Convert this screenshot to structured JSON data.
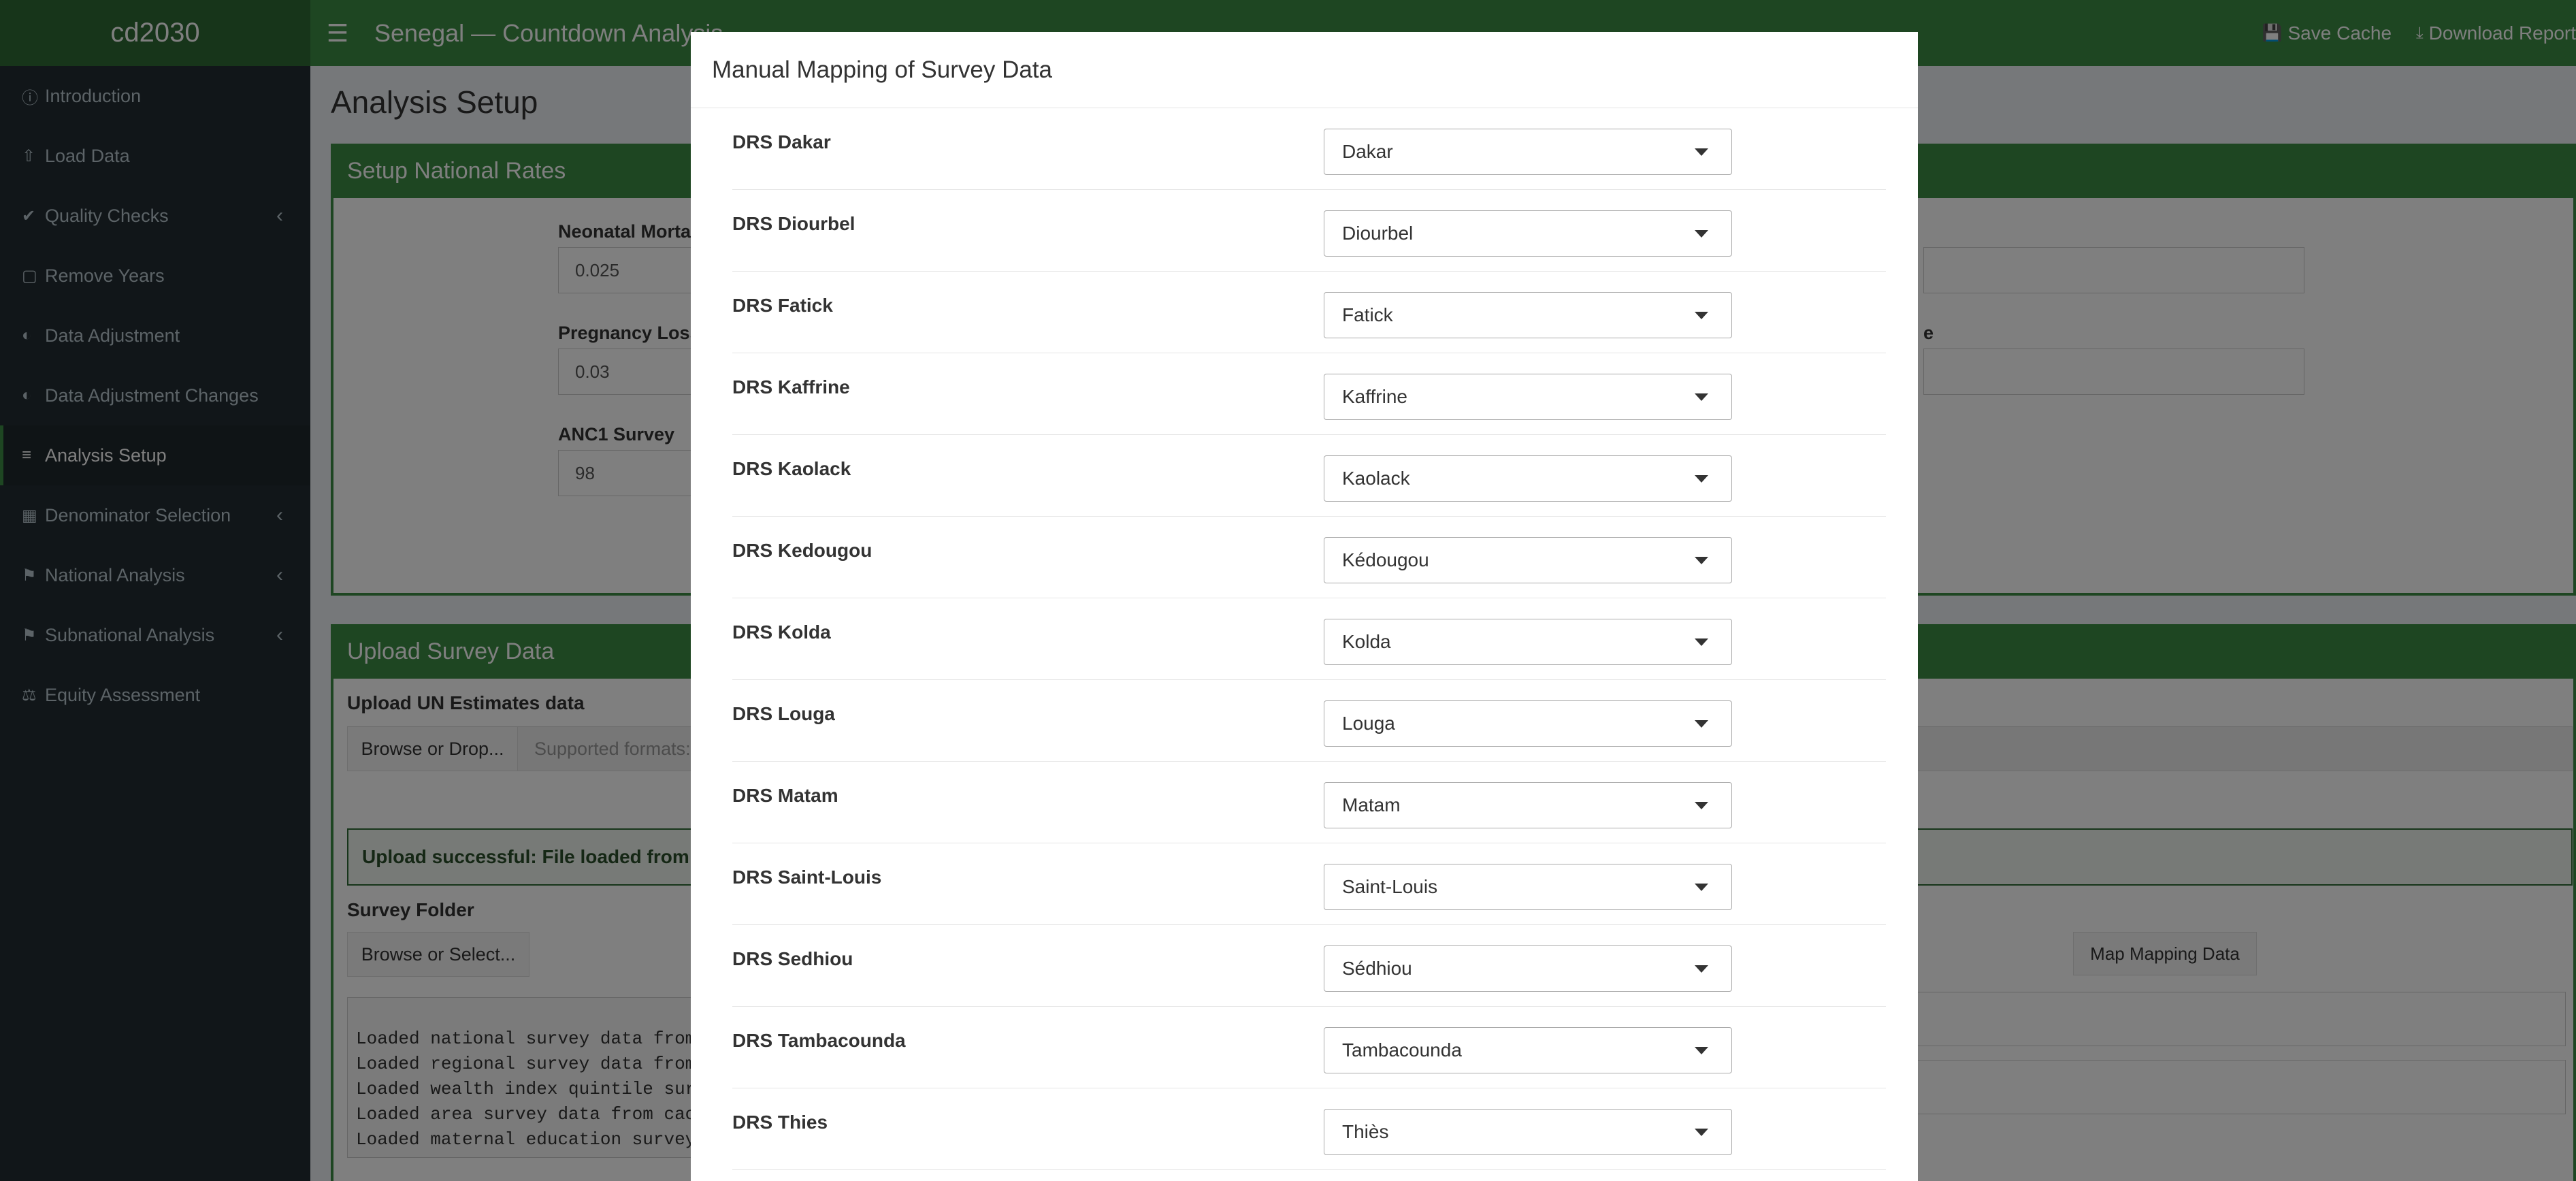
{
  "app": {
    "brand": "cd2030",
    "title": "Senegal — Countdown Analysis",
    "save_cache": "Save Cache",
    "download_report": "Download Report"
  },
  "sidebar": {
    "items": [
      {
        "label": "Introduction",
        "icon": "info-icon"
      },
      {
        "label": "Load Data",
        "icon": "upload-icon"
      },
      {
        "label": "Quality Checks",
        "icon": "check-circle-icon"
      },
      {
        "label": "Remove Years",
        "icon": "trash-icon"
      },
      {
        "label": "Data Adjustment",
        "icon": "adjust-icon"
      },
      {
        "label": "Data Adjustment Changes",
        "icon": "adjust-icon"
      },
      {
        "label": "Analysis Setup",
        "icon": "sliders-icon"
      },
      {
        "label": "Denominator Selection",
        "icon": "calculator-icon"
      },
      {
        "label": "National Analysis",
        "icon": "flag-icon"
      },
      {
        "label": "Subnational Analysis",
        "icon": "flag-icon"
      },
      {
        "label": "Equity Assessment",
        "icon": "balance-icon"
      }
    ]
  },
  "page": {
    "heading": "Analysis Setup",
    "rates_box": {
      "title": "Setup National Rates",
      "fields": [
        {
          "label": "Neonatal Mortality",
          "value": "0.025"
        },
        {
          "label": "Pregnancy Loss",
          "value": "0.03"
        },
        {
          "label": "ANC1 Survey",
          "value": "98"
        }
      ],
      "right_label_fragment": "e"
    },
    "survey_box": {
      "title": "Upload Survey Data",
      "upload_label": "Upload UN Estimates data",
      "browse_label": "Browse or Drop...",
      "formats_hint": "Supported formats:",
      "alert": "Upload successful: File loaded from cac",
      "folder_label": "Survey Folder",
      "folder_button": "Browse or Select...",
      "map_button": "Map Mapping Data",
      "log": [
        "Loaded national survey data from ca",
        "Loaded regional survey data from ca",
        "Loaded wealth index quintile survey",
        "Loaded area survey data from cache.",
        "Loaded maternal education survey da"
      ]
    }
  },
  "modal": {
    "title": "Manual Mapping of Survey Data",
    "rows": [
      {
        "label": "DRS Dakar",
        "selected": "Dakar"
      },
      {
        "label": "DRS Diourbel",
        "selected": "Diourbel"
      },
      {
        "label": "DRS Fatick",
        "selected": "Fatick"
      },
      {
        "label": "DRS Kaffrine",
        "selected": "Kaffrine"
      },
      {
        "label": "DRS Kaolack",
        "selected": "Kaolack"
      },
      {
        "label": "DRS Kedougou",
        "selected": "Kédougou"
      },
      {
        "label": "DRS Kolda",
        "selected": "Kolda"
      },
      {
        "label": "DRS Louga",
        "selected": "Louga"
      },
      {
        "label": "DRS Matam",
        "selected": "Matam"
      },
      {
        "label": "DRS Saint-Louis",
        "selected": "Saint-Louis"
      },
      {
        "label": "DRS Sedhiou",
        "selected": "Sédhiou"
      },
      {
        "label": "DRS Tambacounda",
        "selected": "Tambacounda"
      },
      {
        "label": "DRS Thies",
        "selected": "Thiès"
      }
    ]
  },
  "colors": {
    "header_green": "#3c8d44",
    "sidebar_bg": "#222d32",
    "overlay": "rgba(0,0,0,0.5)"
  }
}
